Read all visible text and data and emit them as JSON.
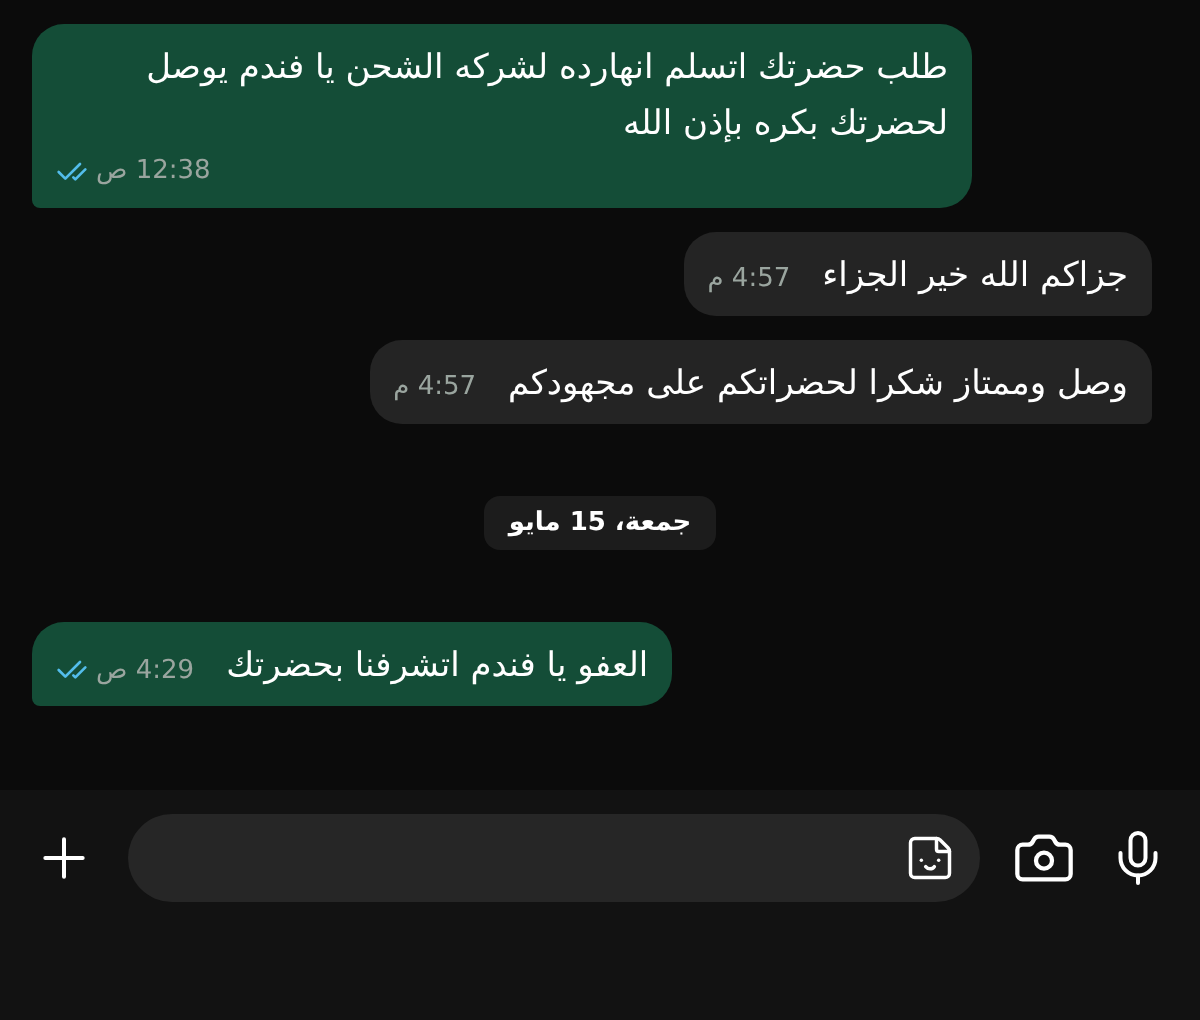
{
  "messages": [
    {
      "kind": "message",
      "outgoing": true,
      "read": true,
      "text": "طلب حضرتك اتسلم انهارده لشركه الشحن يا فندم يوصل لحضرتك بكره بإذن الله",
      "time": "12:38 ص"
    },
    {
      "kind": "message",
      "outgoing": false,
      "text": "جزاكم الله خير الجزاء",
      "time": "4:57 م"
    },
    {
      "kind": "message",
      "outgoing": false,
      "text": "وصل وممتاز شكرا لحضراتكم على مجهودكم",
      "time": "4:57 م"
    },
    {
      "kind": "date",
      "text": "جمعة، 15 مايو"
    },
    {
      "kind": "message",
      "outgoing": true,
      "read": true,
      "text": "العفو يا فندم اتشرفنا بحضرتك",
      "time": "4:29 ص"
    }
  ]
}
